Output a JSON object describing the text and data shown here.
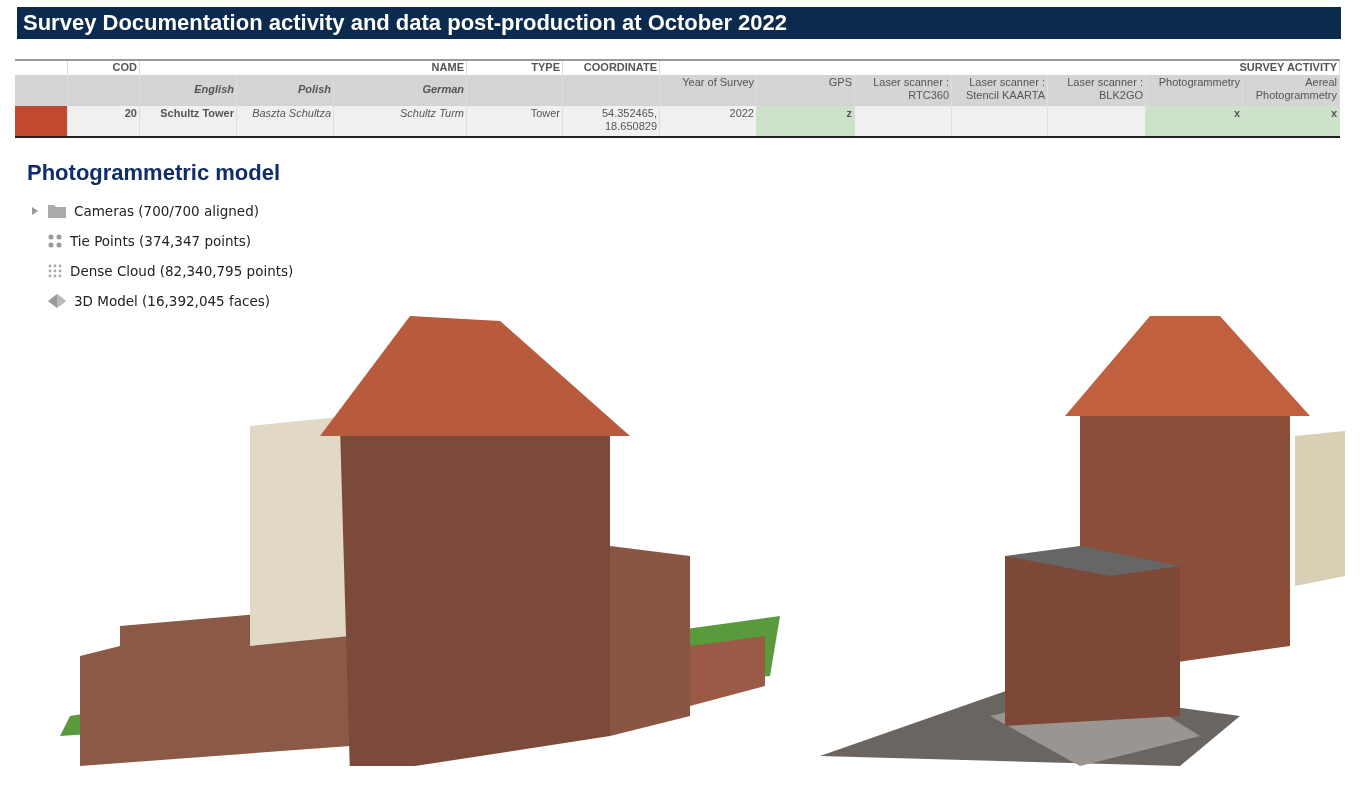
{
  "title": "Survey Documentation activity and data post-production at October 2022",
  "table": {
    "header": [
      {
        "label": "COD"
      },
      {
        "label": "NAME",
        "subcolumns": [
          "English",
          "Polish",
          "German"
        ]
      },
      {
        "label": "TYPE"
      },
      {
        "label": "COORDINATE"
      },
      {
        "label": "SURVEY ACTIVITY",
        "subcolumns": [
          "Year of Survey",
          "GPS",
          "Laser scanner :\nRTC360",
          "Laser scanner :\nStencil KAARTA",
          "Laser scanner :\nBLK2GO",
          "Photogrammetry",
          "Aereal\nPhotogrammetry"
        ]
      }
    ],
    "rows": [
      {
        "color": "#c0492f",
        "cells": [
          {
            "text": "20",
            "bold": true,
            "italic": false,
            "highlighted": false
          },
          {
            "text": "Schultz Tower",
            "bold": true,
            "italic": false,
            "highlighted": false
          },
          {
            "text": "Baszta Schultza",
            "bold": false,
            "italic": true,
            "highlighted": false
          },
          {
            "text": "Schultz Turm",
            "bold": false,
            "italic": true,
            "highlighted": false
          },
          {
            "text": "Tower",
            "bold": false,
            "italic": false,
            "highlighted": false
          },
          {
            "text": "54.352465,\n18.650829",
            "bold": false,
            "italic": false,
            "highlighted": false
          },
          {
            "text": "2022",
            "bold": false,
            "italic": false,
            "highlighted": false
          },
          {
            "text": "z",
            "bold": true,
            "italic": false,
            "highlighted": true
          },
          {
            "highlighted": false
          },
          {
            "highlighted": false
          },
          {
            "highlighted": false
          },
          {
            "text": "x",
            "bold": true,
            "italic": false,
            "highlighted": true
          },
          {
            "text": "x",
            "bold": true,
            "italic": false,
            "highlighted": true
          }
        ]
      }
    ]
  },
  "model_section": {
    "heading": "Photogrammetric model",
    "tree": [
      {
        "kind": "cameras",
        "label": "Cameras (700/700 aligned)",
        "expanded": false
      },
      {
        "kind": "tie-points",
        "label": "Tie Points (374,347 points)"
      },
      {
        "kind": "dense-cloud",
        "label": "Dense Cloud (82,340,795 points)"
      },
      {
        "kind": "model",
        "label": "3D Model (16,392,045 faces)"
      }
    ]
  }
}
